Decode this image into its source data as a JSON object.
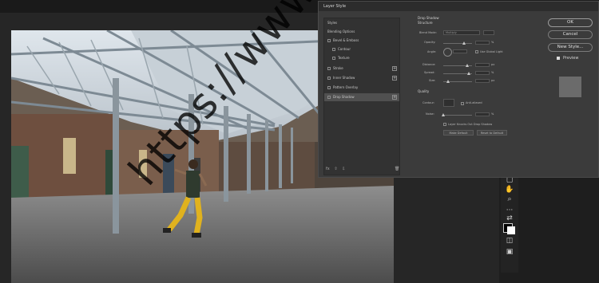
{
  "dialog": {
    "title": "Layer Style",
    "styles_heading": "Styles",
    "blending_options": "Blending Options",
    "items": [
      {
        "label": "Bevel & Emboss",
        "checked": false,
        "plus": false
      },
      {
        "label": "Contour",
        "checked": false,
        "plus": false
      },
      {
        "label": "Texture",
        "checked": false,
        "plus": false
      },
      {
        "label": "Stroke",
        "checked": false,
        "plus": true
      },
      {
        "label": "Inner Shadow",
        "checked": false,
        "plus": true
      },
      {
        "label": "Pattern Overlay",
        "checked": false,
        "plus": false
      },
      {
        "label": "Drop Shadow",
        "checked": false,
        "plus": true
      }
    ],
    "footer_fx": "fx",
    "ok_label": "OK",
    "cancel_label": "Cancel",
    "new_style_label": "New Style...",
    "preview_label": "Preview",
    "panel": {
      "section": "Drop Shadow",
      "structure": "Structure",
      "blend_mode_label": "Blend Mode:",
      "blend_mode_value": "Multiply",
      "opacity_label": "Opacity:",
      "angle_label": "Angle:",
      "use_global_light": "Use Global Light",
      "distance_label": "Distance:",
      "spread_label": "Spread:",
      "size_label": "Size:",
      "quality": "Quality",
      "contour_label": "Contour:",
      "anti_aliased": "Anti-aliased",
      "noise_label": "Noise:",
      "knocks_out": "Layer Knocks Out Drop Shadow",
      "make_default": "Make Default",
      "reset_default": "Reset to Default",
      "unit_px": "px",
      "unit_pct": "%"
    }
  },
  "watermark": "https://www.uptodays.in",
  "tools": [
    "select-icon",
    "hand-icon",
    "zoom-icon",
    "more-icon",
    "swap-icon",
    "color-swatch",
    "mask-icon",
    "screen-mode-icon"
  ],
  "colors": {
    "dialog_bg": "#3b3b3b",
    "workspace_bg": "#262626",
    "selected_row": "#505050"
  }
}
